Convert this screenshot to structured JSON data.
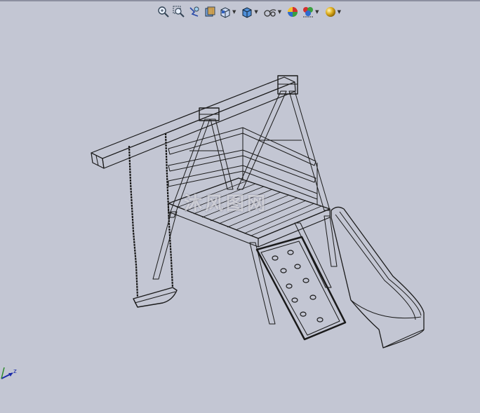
{
  "app": {
    "background": "#c3c6d3",
    "model_line_color": "#1a1a1a"
  },
  "toolbar": {
    "buttons": [
      {
        "name": "zoom-to-fit-icon"
      },
      {
        "name": "zoom-to-area-icon"
      },
      {
        "name": "previous-view-icon"
      },
      {
        "name": "section-view-icon"
      },
      {
        "name": "view-orientation-icon",
        "dropdown": true
      },
      {
        "name": "display-style-icon",
        "dropdown": true
      },
      {
        "name": "hide-show-items-icon",
        "dropdown": true
      },
      {
        "name": "edit-appearance-icon"
      },
      {
        "name": "apply-scene-icon",
        "dropdown": true
      },
      {
        "name": "view-settings-icon",
        "dropdown": true
      }
    ]
  },
  "watermark": {
    "text": "沐风图网"
  },
  "triad": {
    "axis_label": "z"
  }
}
